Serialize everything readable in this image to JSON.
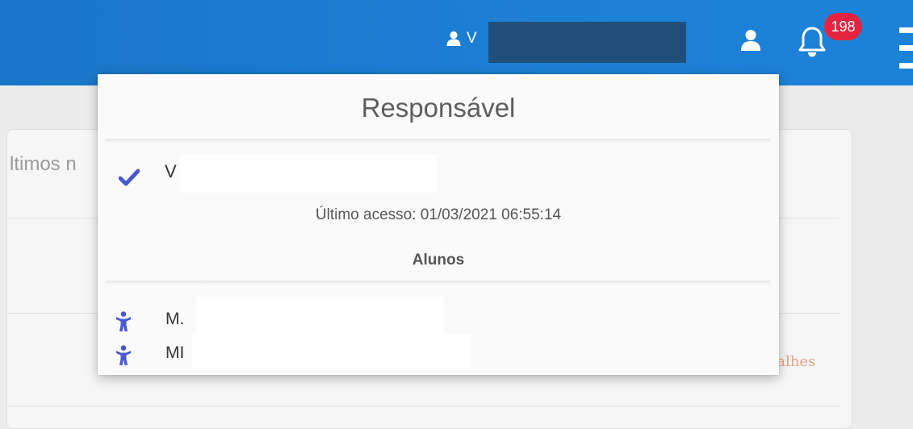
{
  "header": {
    "user_label": "V",
    "notifications_count": "198"
  },
  "background": {
    "section_heading": "ltimos n",
    "details_link": "talhes"
  },
  "dropdown": {
    "title": "Responsável",
    "current_user": {
      "name": "V",
      "selected": true
    },
    "last_access": "Último acesso: 01/03/2021 06:55:14",
    "students_label": "Alunos",
    "students": [
      {
        "name": "M."
      },
      {
        "name": "MI"
      }
    ]
  },
  "colors": {
    "topbar": "#1d7fd4",
    "badge": "#e4233f",
    "accent_icons": "#4a59cf",
    "link": "#e8a286"
  }
}
